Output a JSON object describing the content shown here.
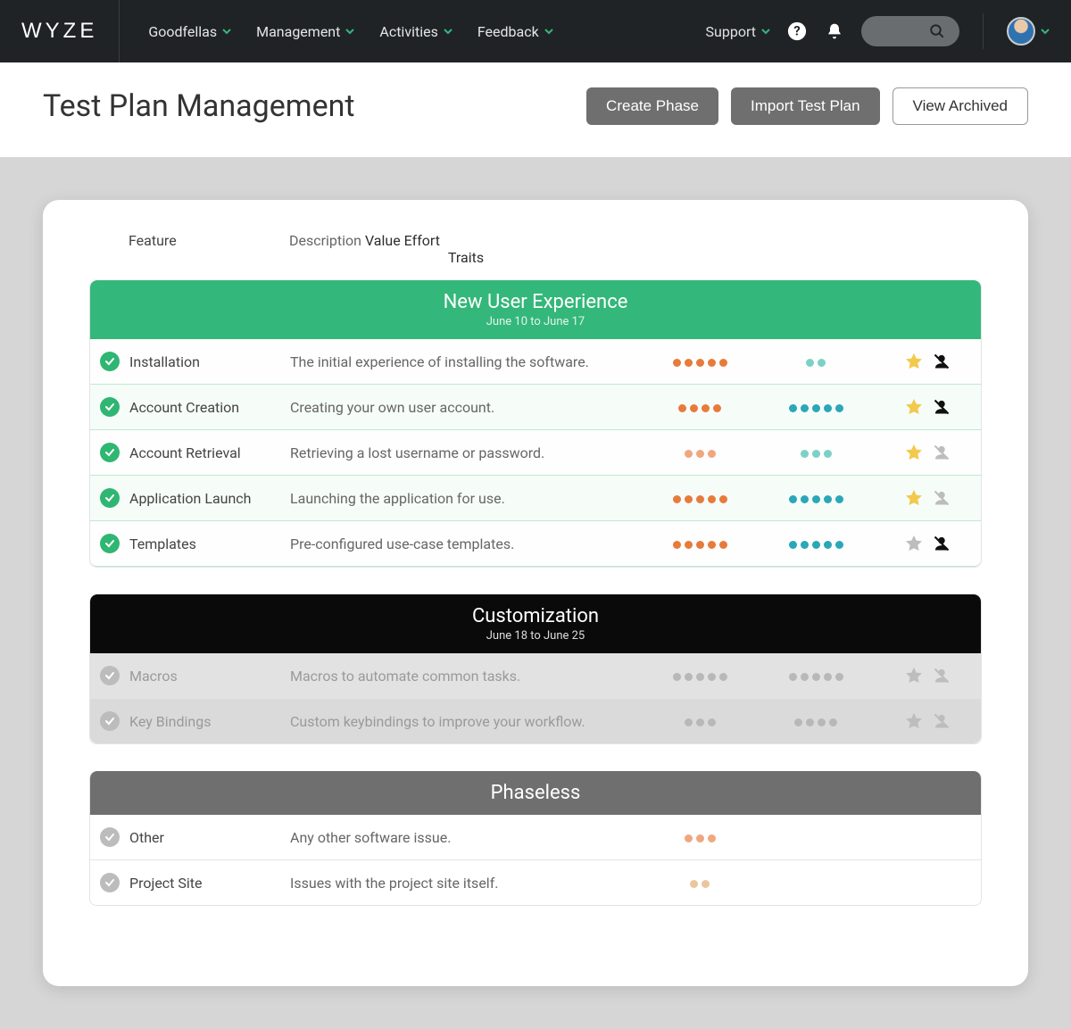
{
  "nav": {
    "logo": "WYZE",
    "links": [
      "Goodfellas",
      "Management",
      "Activities",
      "Feedback"
    ],
    "support": "Support"
  },
  "page": {
    "title": "Test Plan Management",
    "buttons": {
      "create_phase": "Create Phase",
      "import_plan": "Import Test Plan",
      "view_archived": "View Archived"
    }
  },
  "columns": {
    "feature": "Feature",
    "description": "Description",
    "value": "Value",
    "effort": "Effort",
    "traits": "Traits"
  },
  "phases": [
    {
      "id": "nux",
      "style": "green",
      "title": "New User Experience",
      "dates": "June 10 to June 17",
      "rows": [
        {
          "status": "done",
          "feature": "Installation",
          "desc": "The initial experience of installing the software.",
          "value": {
            "n": 5,
            "tone": "orange"
          },
          "effort": {
            "n": 2,
            "tone": "teal-l"
          },
          "traits": {
            "star": "gold",
            "person": "dark"
          }
        },
        {
          "status": "done",
          "feature": "Account Creation",
          "desc": "Creating your own user account.",
          "value": {
            "n": 4,
            "tone": "orange"
          },
          "effort": {
            "n": 5,
            "tone": "teal"
          },
          "traits": {
            "star": "gold",
            "person": "dark"
          }
        },
        {
          "status": "done",
          "feature": "Account Retrieval",
          "desc": "Retrieving a lost username or password.",
          "value": {
            "n": 3,
            "tone": "orange-l"
          },
          "effort": {
            "n": 3,
            "tone": "teal-l"
          },
          "traits": {
            "star": "gold",
            "person": "grey"
          }
        },
        {
          "status": "done",
          "feature": "Application Launch",
          "desc": "Launching the application for use.",
          "value": {
            "n": 5,
            "tone": "orange"
          },
          "effort": {
            "n": 5,
            "tone": "teal"
          },
          "traits": {
            "star": "gold",
            "person": "grey"
          }
        },
        {
          "status": "done",
          "feature": "Templates",
          "desc": "Pre-configured use-case templates.",
          "value": {
            "n": 5,
            "tone": "orange"
          },
          "effort": {
            "n": 5,
            "tone": "teal"
          },
          "traits": {
            "star": "grey",
            "person": "dark"
          }
        }
      ]
    },
    {
      "id": "customization",
      "style": "black",
      "title": "Customization",
      "dates": "June 18 to June 25",
      "rows": [
        {
          "status": "pending",
          "feature": "Macros",
          "desc": "Macros to automate common tasks.",
          "value": {
            "n": 5,
            "tone": "muted"
          },
          "effort": {
            "n": 5,
            "tone": "muted"
          },
          "traits": {
            "star": "grey",
            "person": "grey"
          }
        },
        {
          "status": "pending",
          "feature": "Key Bindings",
          "desc": "Custom keybindings to improve your workflow.",
          "value": {
            "n": 3,
            "tone": "muted"
          },
          "effort": {
            "n": 4,
            "tone": "muted"
          },
          "traits": {
            "star": "grey",
            "person": "grey"
          }
        }
      ]
    },
    {
      "id": "phaseless",
      "style": "grey",
      "title": "Phaseless",
      "dates": "",
      "rows": [
        {
          "status": "pending",
          "feature": "Other",
          "desc": "Any other software issue.",
          "value": {
            "n": 3,
            "tone": "orange-l"
          },
          "effort": {
            "n": 0,
            "tone": ""
          },
          "traits": null
        },
        {
          "status": "pending",
          "feature": "Project Site",
          "desc": "Issues with the project site itself.",
          "value": {
            "n": 2,
            "tone": "tan"
          },
          "effort": {
            "n": 0,
            "tone": ""
          },
          "traits": null
        }
      ]
    }
  ]
}
